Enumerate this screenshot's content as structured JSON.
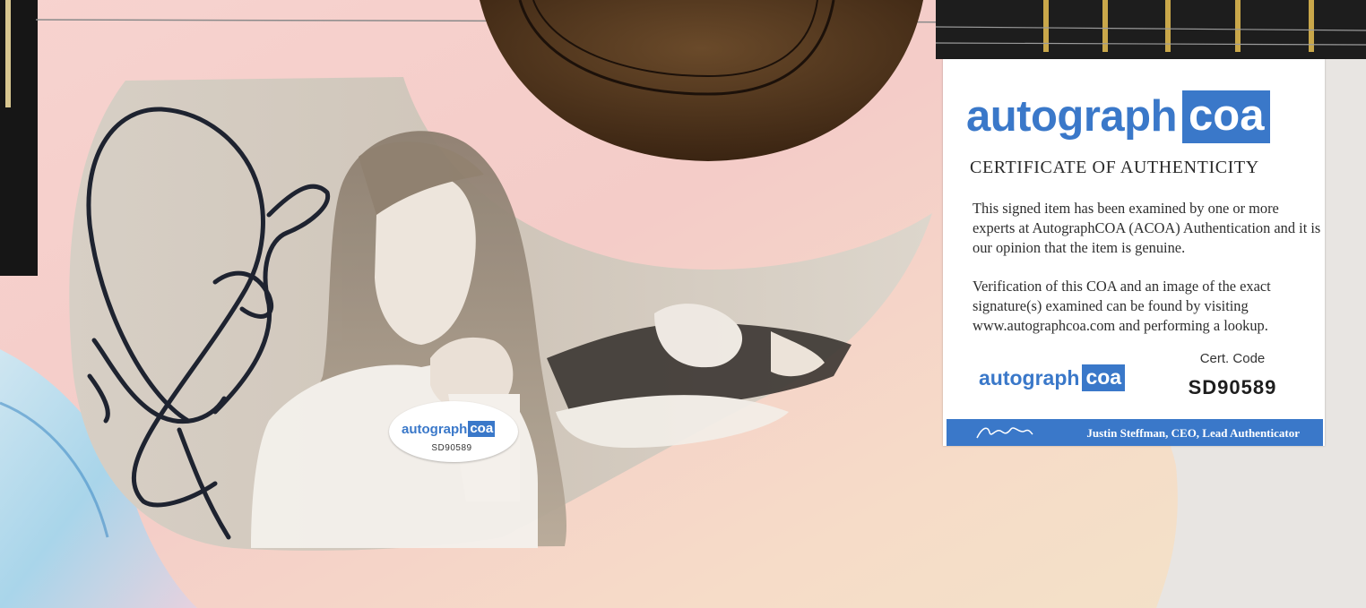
{
  "coa_card": {
    "brand_word": "autograph",
    "brand_box": "coa",
    "title": "CERTIFICATE OF AUTHENTICITY",
    "paragraph_1": "This signed item has been examined by one or more experts at AutographCOA (ACOA) Authentication and it is our opinion that the item is genuine.",
    "paragraph_2": "Verification of this COA and an image of the exact signature(s) examined can be found by visiting www.autographcoa.com and performing a lookup.",
    "small_brand_word": "autograph",
    "small_brand_box": "coa",
    "cert_label": "Cert. Code",
    "cert_code": "SD90589",
    "footer_text": "Justin Steffman, CEO, Lead Authenticator"
  },
  "sticker": {
    "brand_word": "autograph",
    "brand_box": "coa",
    "code": "SD90589"
  },
  "colors": {
    "brand_blue": "#3a78c9",
    "guitar_pink": "#f5cfcd",
    "guitar_peach": "#f6dfc6",
    "fretboard": "#1d1d1d",
    "fret_gold": "#c9a74a",
    "signature_ink": "#1e2330"
  }
}
